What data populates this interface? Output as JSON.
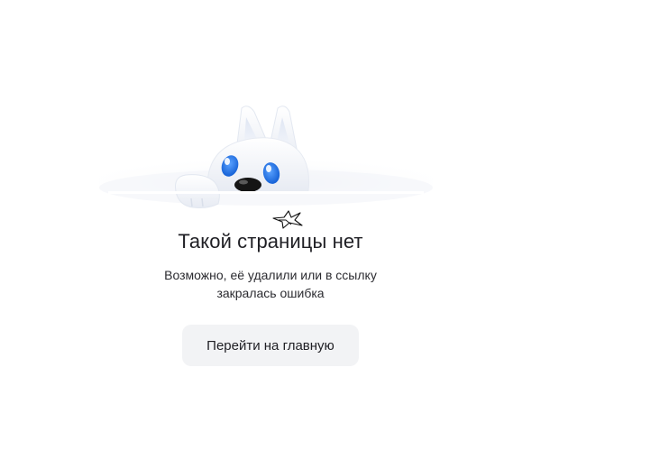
{
  "error": {
    "title": "Такой страницы нет",
    "subtitle_line1": "Возможно, её удалили или в ссылку",
    "subtitle_line2": "закралась ошибка",
    "home_button_label": "Перейти на главную"
  },
  "illustration": {
    "mascot": "white-fox-mascot-peeking",
    "eye_color": "#1a73e8",
    "cursor_icon": "hand-drawn-cursor-scribble"
  }
}
